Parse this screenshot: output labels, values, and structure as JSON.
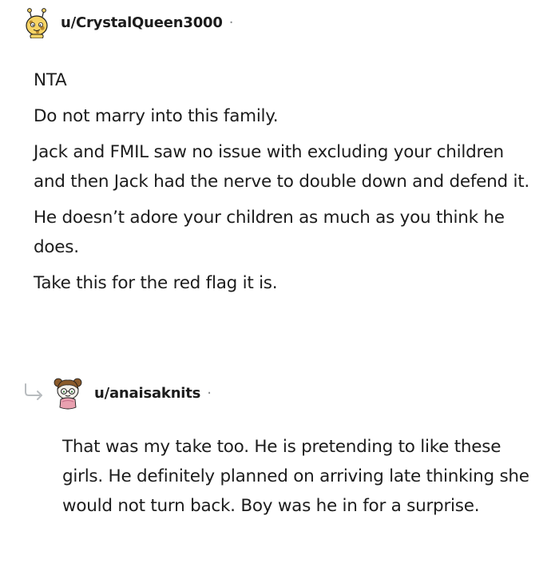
{
  "comment": {
    "username": "u/CrystalQueen3000",
    "separator": "·",
    "avatar_icon": "snoo-giraffe-avatar-icon",
    "paragraphs": [
      "NTA",
      "Do not marry into this family.",
      "Jack and FMIL saw no issue with excluding your children and then Jack had the nerve to double down and defend it.",
      "He doesn’t adore your children as much as you think he does.",
      "Take this for the red flag it is."
    ]
  },
  "reply": {
    "reply_icon": "reply-arrow-icon",
    "username": "u/anaisaknits",
    "separator": "·",
    "avatar_icon": "snoo-bun-hair-avatar-icon",
    "paragraphs": [
      "That was my take too. He is pretending to like these girls. He definitely planned on arriving late thinking she would not turn back. Boy was he in for a surprise."
    ]
  },
  "colors": {
    "text": "#1c1c1c",
    "meta": "#878a8c",
    "reply_arrow": "#b8bcbf"
  }
}
